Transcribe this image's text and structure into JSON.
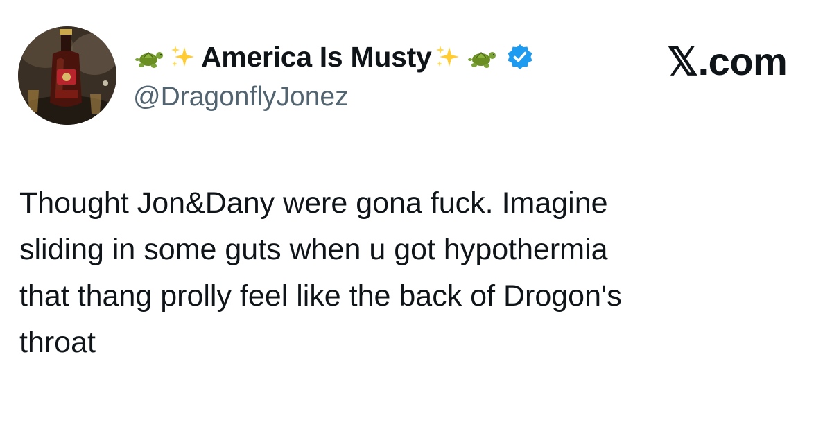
{
  "tweet": {
    "author": {
      "display_name": "America Is Musty",
      "name_emojis_before": [
        "turtle-emoji",
        "sparkles-emoji"
      ],
      "name_emojis_after": [
        "sparkles-emoji",
        "turtle-emoji"
      ],
      "verified": true,
      "handle": "@DragonflyJonez",
      "avatar": "avatar-photo-liquor-bottle"
    },
    "source": "𝕏.com",
    "text_lines": [
      "Thought Jon&Dany were gona fuck. Imagine",
      "sliding in some guts when u got hypothermia",
      "that thang prolly feel like the back of Drogon's",
      "throat"
    ]
  },
  "colors": {
    "text_primary": "#0f1419",
    "text_secondary": "#536471",
    "verified_blue": "#1d9bf0",
    "background": "#ffffff"
  }
}
